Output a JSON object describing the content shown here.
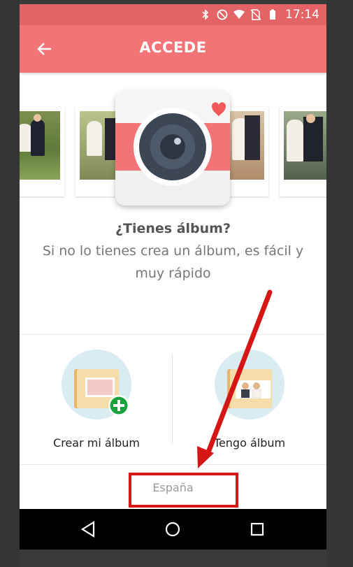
{
  "status_bar": {
    "time": "17:14",
    "icons": [
      "bluetooth-icon",
      "do-not-disturb-icon",
      "wifi-icon",
      "no-sim-icon",
      "battery-icon"
    ]
  },
  "app_bar": {
    "title": "ACCEDE",
    "back_icon": "arrow-left-icon"
  },
  "intro": {
    "question": "¿Tienes álbum?",
    "subtitle": "Si no lo tienes crea un álbum, es fácil y muy rápido"
  },
  "options": [
    {
      "label": "Crear mi álbum",
      "icon": "create-album-icon"
    },
    {
      "label": "Tengo álbum",
      "icon": "have-album-icon"
    }
  ],
  "footer": {
    "country": "España"
  },
  "nav_bar": {
    "buttons": [
      "back-triangle-icon",
      "home-circle-icon",
      "recents-square-icon"
    ]
  },
  "colors": {
    "app_bar": "#f27477",
    "status_bar": "#e46466",
    "annotation": "#d61515",
    "add_badge": "#1aa33a"
  }
}
